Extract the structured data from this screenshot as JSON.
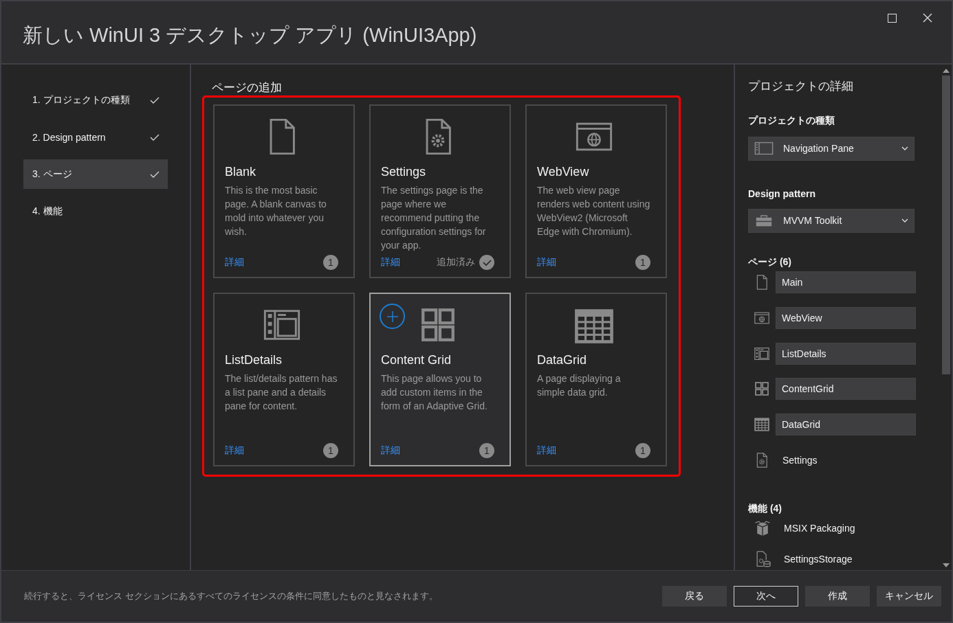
{
  "window": {
    "title": "新しい WinUI 3 デスクトップ アプリ (WinUI3App)"
  },
  "steps": [
    {
      "label": "1. プロジェクトの種類",
      "done": true,
      "selected": false
    },
    {
      "label": "2. Design pattern",
      "done": true,
      "selected": false
    },
    {
      "label": "3. ページ",
      "done": true,
      "selected": true
    },
    {
      "label": "4. 機能",
      "done": false,
      "selected": false
    }
  ],
  "content": {
    "heading": "ページの追加",
    "cards": [
      {
        "kind": "blank",
        "title": "Blank",
        "description": "This is the most basic page. A blank canvas to mold into whatever you wish.",
        "link": "詳細",
        "status": {
          "kind": "count",
          "text": "1"
        },
        "selected": false
      },
      {
        "kind": "settings",
        "title": "Settings",
        "description": "The settings page is the page where we recommend putting the configuration settings for your app.",
        "link": "詳細",
        "status": {
          "kind": "added",
          "text": "追加済み"
        },
        "selected": false
      },
      {
        "kind": "webview",
        "title": "WebView",
        "description": "The web view page renders web content using WebView2 (Microsoft Edge with Chromium).",
        "link": "詳細",
        "status": {
          "kind": "count",
          "text": "1"
        },
        "selected": false
      },
      {
        "kind": "listdetails",
        "title": "ListDetails",
        "description": "The list/details pattern has a list pane and a details pane for content.",
        "link": "詳細",
        "status": {
          "kind": "count",
          "text": "1"
        },
        "selected": false
      },
      {
        "kind": "contentgrid",
        "title": "Content Grid",
        "description": "This page allows you to add custom items in the form of an Adaptive Grid.",
        "link": "詳細",
        "status": {
          "kind": "count",
          "text": "1"
        },
        "selected": true
      },
      {
        "kind": "datagrid",
        "title": "DataGrid",
        "description": "A page displaying a simple data grid.",
        "link": "詳細",
        "status": {
          "kind": "count",
          "text": "1"
        },
        "selected": false
      }
    ]
  },
  "details": {
    "heading": "プロジェクトの詳細",
    "project_type": {
      "label": "プロジェクトの種類",
      "kind": "navpane",
      "value": "Navigation Pane"
    },
    "design_pattern": {
      "label": "Design pattern",
      "kind": "toolkit",
      "value": "MVVM Toolkit"
    },
    "pages": {
      "label": "ページ (6)",
      "items": [
        {
          "kind": "blank",
          "name": "Main",
          "editable": true
        },
        {
          "kind": "webview",
          "name": "WebView",
          "editable": true
        },
        {
          "kind": "listdetails",
          "name": "ListDetails",
          "editable": true
        },
        {
          "kind": "contentgrid",
          "name": "ContentGrid",
          "editable": true
        },
        {
          "kind": "datagrid",
          "name": "DataGrid",
          "editable": true
        },
        {
          "kind": "settings",
          "name": "Settings",
          "editable": false
        }
      ]
    },
    "features": {
      "label": "機能 (4)",
      "items": [
        {
          "kind": "package",
          "name": "MSIX Packaging"
        },
        {
          "kind": "storage",
          "name": "SettingsStorage"
        }
      ]
    }
  },
  "footer": {
    "notice": "続行すると、ライセンス セクションにあるすべてのライセンスの条件に同意したものと見なされます。",
    "buttons": [
      {
        "label": "戻る",
        "focused": false
      },
      {
        "label": "次へ",
        "focused": true
      },
      {
        "label": "作成",
        "focused": false
      },
      {
        "label": "キャンセル",
        "focused": false
      }
    ]
  }
}
